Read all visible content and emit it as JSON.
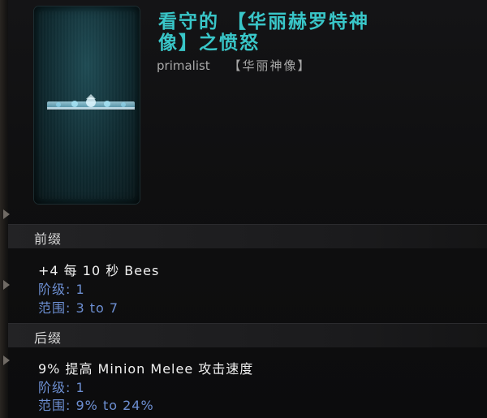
{
  "item": {
    "title": "看守的【华丽赫罗特神像】之愤怒",
    "title_line1": "看守的 【华丽赫罗特神",
    "title_line2": "像】之愤怒",
    "class": "primalist",
    "base_type": "【华丽神像】",
    "art_icon": "ornate-idol-icon"
  },
  "sections": [
    {
      "header": "前缀",
      "lines": [
        {
          "text": "+4 每 10 秒 Bees",
          "kind": "mod"
        },
        {
          "text": "阶级: 1",
          "kind": "info"
        },
        {
          "text": "范围: 3 to 7",
          "kind": "info"
        }
      ]
    },
    {
      "header": "后缀",
      "lines": [
        {
          "text": "9% 提高 Minion Melee 攻击速度",
          "kind": "mod"
        },
        {
          "text": "阶级: 1",
          "kind": "info"
        },
        {
          "text": "范围: 9% to 24%",
          "kind": "info"
        }
      ]
    }
  ],
  "colors": {
    "title": "#39c6c8",
    "subtitle": "#a8a8a8",
    "mod_text": "#f1f1f1",
    "info_text": "#6d8fd2",
    "header_text": "#d6d6d6",
    "background": "#0d0d0e"
  }
}
